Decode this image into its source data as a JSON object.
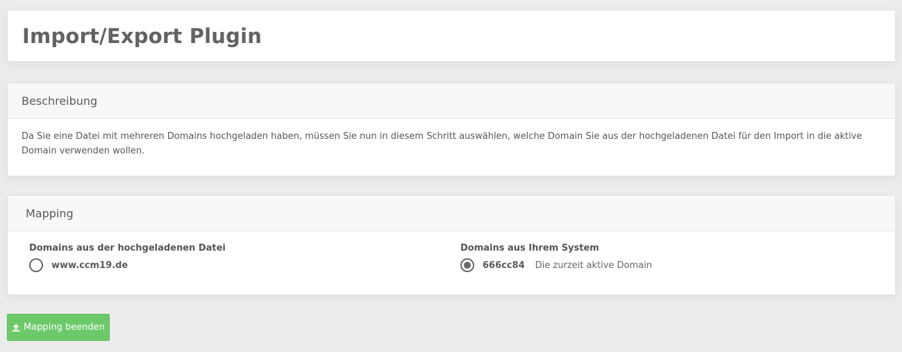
{
  "page": {
    "title": "Import/Export Plugin"
  },
  "description": {
    "header": "Beschreibung",
    "text": "Da Sie eine Datei mit mehreren Domains hochgeladen haben, müssen Sie nun in diesem Schritt auswählen, welche Domain Sie aus der hochgeladenen Datei für den Import in die aktive Domain verwenden wollen."
  },
  "mapping": {
    "header": "Mapping",
    "uploaded": {
      "label": "Domains aus der hochgeladenen Datei",
      "options": [
        {
          "name": "www.ccm19.de",
          "selected": false
        }
      ]
    },
    "system": {
      "label": "Domains aus Ihrem System",
      "options": [
        {
          "name": "666cc84",
          "hint": "Die zurzeit aktive Domain",
          "selected": true
        }
      ]
    }
  },
  "actions": {
    "finish_label": "Mapping beenden",
    "finish_icon": "upload-icon",
    "finish_color": "#6cc96a"
  }
}
